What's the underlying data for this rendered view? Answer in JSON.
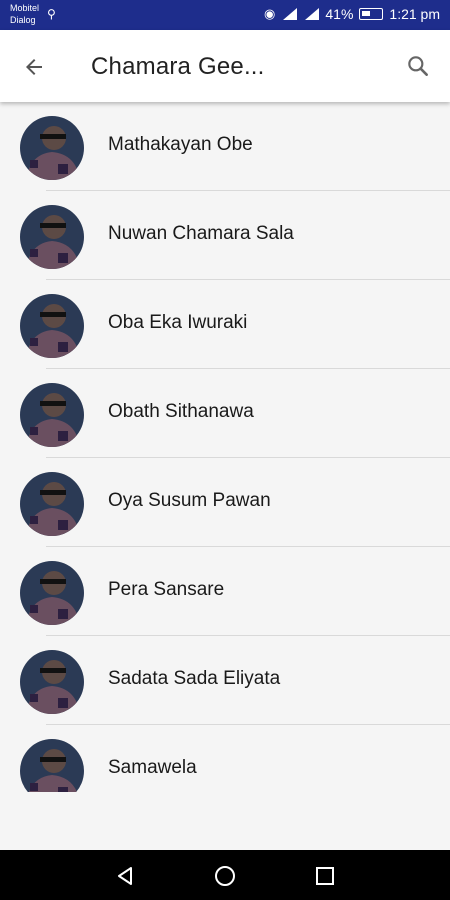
{
  "status_bar": {
    "carrier1": "Mobitel",
    "carrier2": "Dialog",
    "battery_pct": "41%",
    "time": "1:21 pm"
  },
  "app_bar": {
    "title": "Chamara Gee...",
    "back_icon": "arrow-back-icon",
    "search_icon": "search-icon"
  },
  "songs": [
    {
      "title": "Mathakayan Obe"
    },
    {
      "title": "Nuwan Chamara Sala"
    },
    {
      "title": "Oba Eka Iwuraki"
    },
    {
      "title": "Obath Sithanawa"
    },
    {
      "title": "Oya Susum Pawan"
    },
    {
      "title": "Pera Sansare"
    },
    {
      "title": "Sadata Sada Eliyata"
    },
    {
      "title": "Samawela"
    }
  ],
  "nav_bar": {
    "back_icon": "nav-back-icon",
    "home_icon": "nav-home-icon",
    "recents_icon": "nav-recents-icon"
  },
  "colors": {
    "status_bar_bg": "#1e2d8c",
    "app_bar_bg": "#ffffff",
    "list_bg": "#f5f5f5",
    "nav_bar_bg": "#000000"
  }
}
